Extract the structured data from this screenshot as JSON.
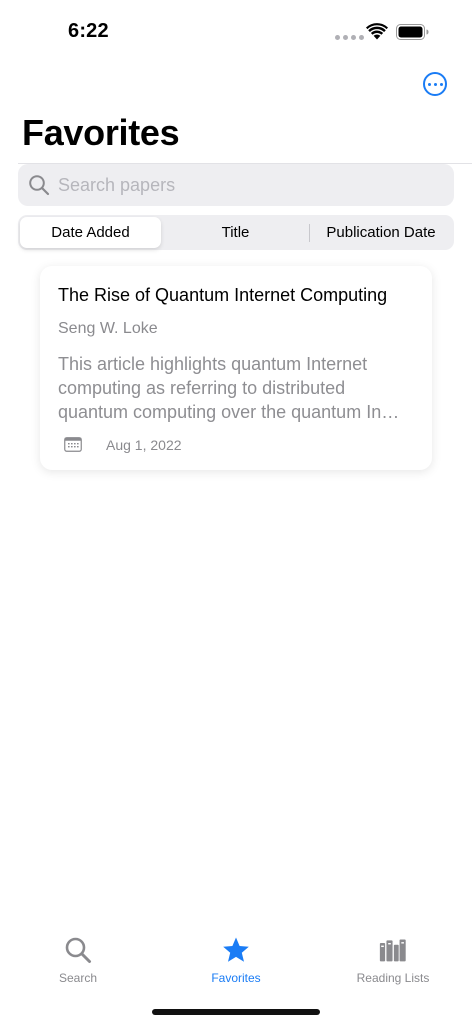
{
  "status_bar": {
    "time": "6:22"
  },
  "header": {
    "title": "Favorites",
    "more_icon": "ellipsis-circle-icon"
  },
  "search": {
    "placeholder": "Search papers",
    "icon": "search-icon"
  },
  "sort_segments": [
    {
      "label": "Date Added",
      "selected": true
    },
    {
      "label": "Title",
      "selected": false
    },
    {
      "label": "Publication Date",
      "selected": false
    }
  ],
  "papers": [
    {
      "title": "The Rise of Quantum Internet Computing",
      "author": "Seng W. Loke",
      "abstract": "This article highlights quantum Internet computing as referring to distributed quantum computing over the quantum In…",
      "date": "Aug 1, 2022",
      "date_icon": "calendar-icon"
    }
  ],
  "tab_bar": {
    "tabs": [
      {
        "label": "Search",
        "icon": "search-icon",
        "active": false
      },
      {
        "label": "Favorites",
        "icon": "star-icon",
        "active": true
      },
      {
        "label": "Reading Lists",
        "icon": "books-icon",
        "active": false
      }
    ]
  },
  "colors": {
    "accent": "#1a7cf5",
    "secondary_text": "#8a8a8e",
    "field_bg": "#eeeef1"
  }
}
